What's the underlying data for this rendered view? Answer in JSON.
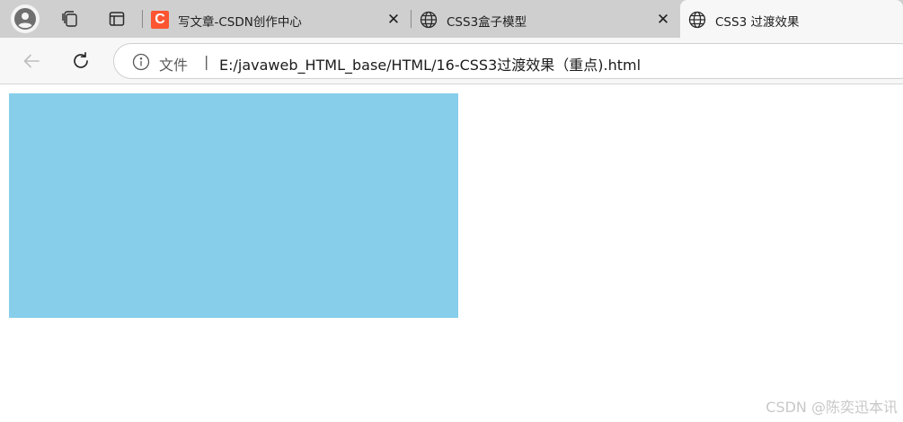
{
  "browser": {
    "tabs": [
      {
        "title": "写文章-CSDN创作中心",
        "favicon": "C",
        "favicon_color": "#fc5531",
        "active": false,
        "close": "✕"
      },
      {
        "title": "CSS3盒子模型",
        "favicon": "globe-icon",
        "active": false,
        "close": "✕"
      },
      {
        "title": "CSS3 过渡效果",
        "favicon": "globe-icon",
        "active": true
      }
    ],
    "address": {
      "scheme_label": "文件",
      "divider": "|",
      "url": "E:/javaweb_HTML_base/HTML/16-CSS3过渡效果（重点).html"
    }
  },
  "page": {
    "box_color": "#87ceeb",
    "watermark": "CSDN @陈奕迅本讯"
  },
  "colors": {
    "tabstrip": "#cfcfcf",
    "active_tab": "#f7f7f7",
    "toolbar": "#f7f7f7"
  }
}
